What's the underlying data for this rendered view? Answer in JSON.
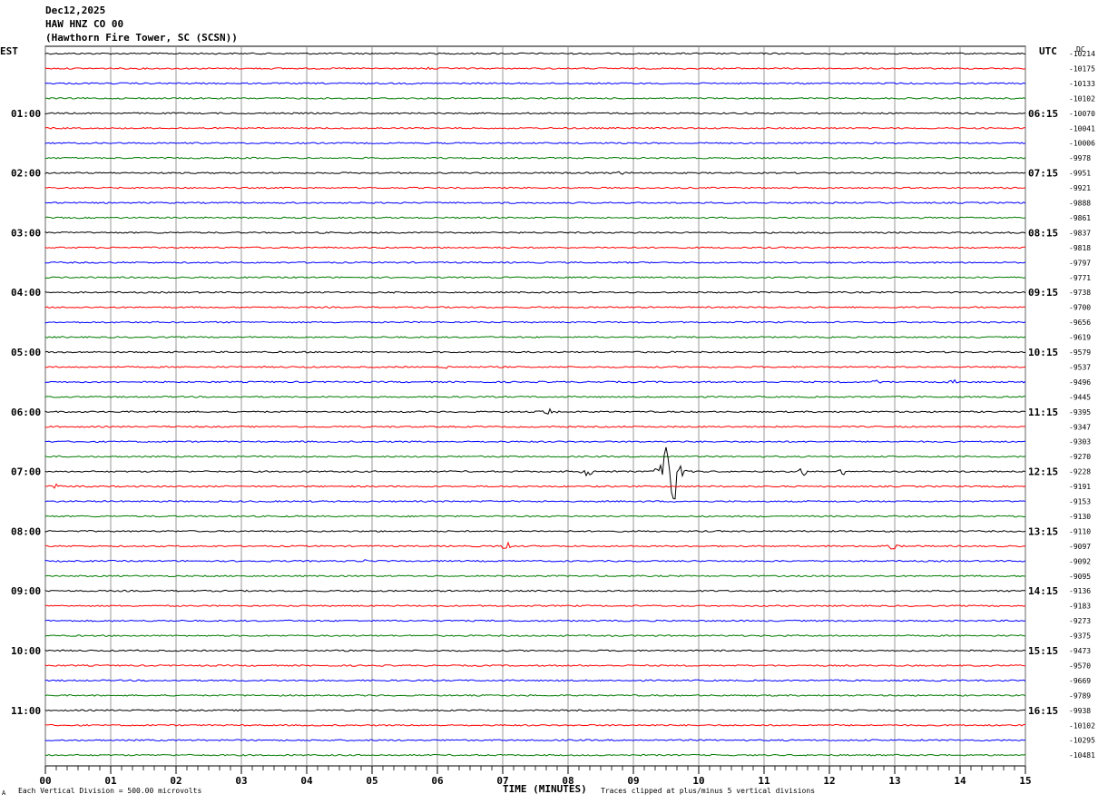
{
  "header": {
    "date": "Dec12,2025",
    "channel": "HAW HNZ CO 00",
    "station": "(Hawthorn Fire Tower, SC (SCSN))"
  },
  "left_axis_label": "EST",
  "right_axis_label": "UTC",
  "dc_label": "DC",
  "footer": {
    "scale_note": "Each Vertical Division =  500.00 microvolts",
    "xlabel": "TIME (MINUTES)",
    "clip_note": "Traces clipped at plus/minus 5 vertical divisions",
    "corner_mark": "A"
  },
  "colors": {
    "cycle": [
      "#000000",
      "#ff0000",
      "#0000ff",
      "#007a00"
    ],
    "grid": "#808080"
  },
  "chart_data": {
    "type": "line",
    "xlim": [
      0,
      15
    ],
    "x_ticks": [
      "00",
      "01",
      "02",
      "03",
      "04",
      "05",
      "06",
      "07",
      "08",
      "09",
      "10",
      "11",
      "12",
      "13",
      "14",
      "15"
    ],
    "traces_per_hour": 4,
    "minutes_per_trace": 15,
    "est_hour_labels": [
      "01:00",
      "02:00",
      "03:00",
      "04:00",
      "05:00",
      "06:00",
      "07:00",
      "08:00",
      "09:00",
      "10:00",
      "11:00"
    ],
    "utc_hour_labels": [
      "06:15",
      "07:15",
      "08:15",
      "09:15",
      "10:15",
      "11:15",
      "12:15",
      "13:15",
      "14:15",
      "15:15",
      "16:15"
    ],
    "dc_offsets": [
      "-10214",
      "-10175",
      "-10133",
      "-10102",
      "-10070",
      "-10041",
      "-10006",
      "-9978",
      "-9951",
      "-9921",
      "-9888",
      "-9861",
      "-9837",
      "-9818",
      "-9797",
      "-9771",
      "-9738",
      "-9700",
      "-9656",
      "-9619",
      "-9579",
      "-9537",
      "-9496",
      "-9445",
      "-9395",
      "-9347",
      "-9303",
      "-9270",
      "-9228",
      "-9191",
      "-9153",
      "-9130",
      "-9110",
      "-9097",
      "-9092",
      "-9095",
      "-9136",
      "-9183",
      "-9273",
      "-9375",
      "-9473",
      "-9570",
      "-9669",
      "-9789",
      "-9938",
      "-10102",
      "-10295",
      "-10481"
    ],
    "events": [
      {
        "trace": 1,
        "minute": 5.9,
        "amp": 2
      },
      {
        "trace": 8,
        "minute": 8.85,
        "amp": 4
      },
      {
        "trace": 21,
        "minute": 6.1,
        "amp": 3
      },
      {
        "trace": 22,
        "minute": 12.7,
        "amp": 3
      },
      {
        "trace": 22,
        "minute": 13.9,
        "amp": 4
      },
      {
        "trace": 24,
        "minute": 7.7,
        "amp": 5
      },
      {
        "trace": 28,
        "minute": 9.57,
        "amp": 80
      },
      {
        "trace": 28,
        "minute": 8.3,
        "amp": 8
      },
      {
        "trace": 28,
        "minute": 11.6,
        "amp": 6
      },
      {
        "trace": 28,
        "minute": 12.2,
        "amp": 5
      },
      {
        "trace": 29,
        "minute": 0.15,
        "amp": 6
      },
      {
        "trace": 33,
        "minute": 7.05,
        "amp": 10
      },
      {
        "trace": 33,
        "minute": 12.95,
        "amp": 6
      },
      {
        "trace": 34,
        "minute": 4.9,
        "amp": 3
      }
    ]
  }
}
